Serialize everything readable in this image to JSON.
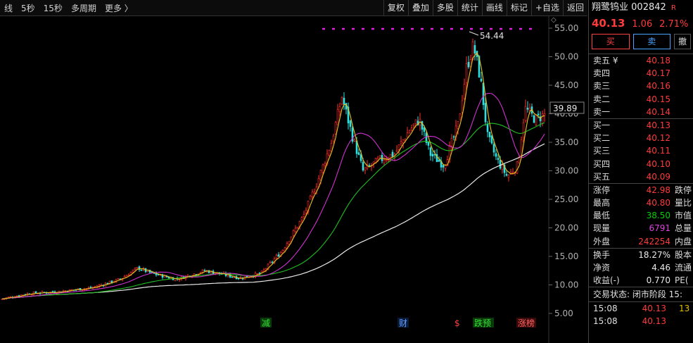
{
  "toolbar": {
    "left": [
      "线",
      "5秒",
      "15秒",
      "多周期",
      "更多 〉"
    ],
    "right": [
      "复权",
      "叠加",
      "多股",
      "统计",
      "画线",
      "标记",
      "+自选",
      "返回"
    ]
  },
  "chart": {
    "y_ticks": [
      "55.00",
      "50.00",
      "45.00",
      "40.00",
      "35.00",
      "30.00",
      "25.00",
      "20.00",
      "15.00",
      "10.00",
      "5.00"
    ],
    "current_price_label": "39.89",
    "high_marker_label": "54.44",
    "event_markers": [
      "减",
      "财",
      "$",
      "跌预",
      "涨榜"
    ]
  },
  "stock": {
    "name": "翔鹭钨业",
    "code": "002842",
    "badge": "R",
    "price": "40.13",
    "change": "1.06",
    "change_pct": "2.71%"
  },
  "buttons": {
    "buy": "买",
    "sell": "卖",
    "other": "撤"
  },
  "order_book": [
    {
      "label": "卖五 ¥",
      "price": "40.18"
    },
    {
      "label": "卖四",
      "price": "40.17"
    },
    {
      "label": "卖三",
      "price": "40.16"
    },
    {
      "label": "卖二",
      "price": "40.15"
    },
    {
      "label": "卖一",
      "price": "40.14"
    },
    {
      "label": "买一",
      "price": "40.13"
    },
    {
      "label": "买二",
      "price": "40.12"
    },
    {
      "label": "买三",
      "price": "40.11"
    },
    {
      "label": "买四",
      "price": "40.10"
    },
    {
      "label": "买五",
      "price": "40.09"
    }
  ],
  "stats": [
    {
      "label": "涨停",
      "value": "42.98",
      "extra": "跌停"
    },
    {
      "label": "最高",
      "value": "40.80",
      "extra": "量比"
    },
    {
      "label": "最低",
      "value": "38.50",
      "extra": "市值"
    },
    {
      "label": "现量",
      "value": "6791",
      "extra": "总量"
    },
    {
      "label": "外盘",
      "value": "242254",
      "extra": "内盘"
    }
  ],
  "fundamentals": [
    {
      "label": "换手",
      "value": "18.27%",
      "extra": "股本"
    },
    {
      "label": "净资",
      "value": "4.46",
      "extra": "流通"
    },
    {
      "label": "收益(-)",
      "value": "0.770",
      "extra": "PE("
    }
  ],
  "trade_status": "交易状态: 闭市阶段 15:",
  "ticks": [
    {
      "time": "15:08",
      "price": "40.13",
      "vol": "13"
    },
    {
      "time": "15:08",
      "price": "40.13",
      "vol": ""
    }
  ]
}
